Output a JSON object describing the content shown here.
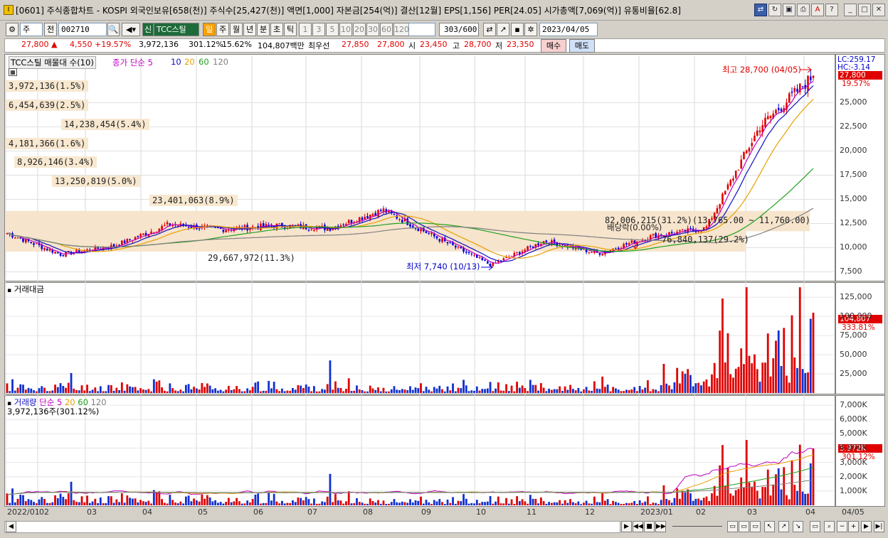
{
  "window": {
    "title": "[0601] 주식종합차트 - KOSPI 외국인보유[658(천)] 주식수[25,427(천)] 액면[1,000] 자본금[254(억)] 결산[12월] EPS[1,156] PER[24.05] 시가총액[7,069(억)] 유통비율[62.8]",
    "app_icon": "I"
  },
  "toolbar": {
    "market_type": "주",
    "prev_label": "전",
    "code": "002710",
    "stock_name": "TCC스틸",
    "stock_badge": "신",
    "periods": [
      "일",
      "주",
      "월",
      "년",
      "분",
      "초",
      "틱"
    ],
    "active_period": "일",
    "intervals": [
      "1",
      "3",
      "5",
      "10",
      "20",
      "30",
      "60",
      "120"
    ],
    "count_value": "303",
    "count_total": "/600",
    "date": "2023/04/05"
  },
  "pricebar": {
    "price": "27,800",
    "arrow": "▲",
    "change": "4,550",
    "change_pct": "+19.57%",
    "volume": "3,972,136",
    "vol_ratio": "301.12%",
    "turnover": "15.62%",
    "amount": "104,807백만",
    "best_label": "최우선",
    "ask": "27,850",
    "bid": "27,800",
    "open_label": "시",
    "open": "23,450",
    "high_label": "고",
    "high": "28,700",
    "low_label": "저",
    "low": "23,350",
    "buy_label": "매수",
    "sell_label": "매도"
  },
  "price_panel": {
    "legend_name": "TCC스틸 매물대 수(10)",
    "legend_ma": "종가 단순 5",
    "ma_periods": [
      "10",
      "20",
      "60",
      "120"
    ],
    "ma_colors": [
      "#c000c0",
      "#1010c0",
      "#e8a000",
      "#20a020",
      "#808080"
    ],
    "top_right_lc": "LC:259.17",
    "top_right_hc": "HC:-3.14",
    "last_price": "27,800",
    "last_pct": "19.57%",
    "high_note": "최고 28,700 (04/05)",
    "low_note": "최저 7,740 (10/13)",
    "dividend_note": "배당락(0.00%)",
    "vp_labels": [
      "3,972,136(1.5%)",
      "6,454,639(2.5%)",
      "14,238,454(5.4%)",
      "4,181,366(1.6%)",
      "8,926,146(3.4%)",
      "13,250,819(5.0%)",
      "23,401,063(8.9%)",
      "82,006,215(31.2%)(13,765.00 ~ 11,760.00)",
      "76,840,137(29.2%)",
      "29,667,972(11.3%)"
    ]
  },
  "amount_panel": {
    "title": "거래대금",
    "last_value": "104,807",
    "last_pct": "333.81%"
  },
  "volume_panel": {
    "legend_name": "거래량",
    "legend_ma": "단순 5",
    "ma_periods": [
      "20",
      "60",
      "120"
    ],
    "sub_label": "3,972,136주(301.12%)",
    "last_value": "3,972K",
    "last_pct": "301.12%"
  },
  "chart_data": [
    {
      "type": "candlestick",
      "title": "TCC스틸 일봉",
      "x_range": [
        "2022/01/02",
        "2023/04/05"
      ],
      "y_ticks": [
        "7,500",
        "10,000",
        "12,500",
        "15,000",
        "17,500",
        "20,000",
        "22,500",
        "25,000"
      ],
      "ylim": [
        6800,
        29300
      ],
      "series_closes_monthly": [
        {
          "x": "2022/01",
          "y": 11500
        },
        {
          "x": "2022/02",
          "y": 9300
        },
        {
          "x": "2022/03",
          "y": 10200
        },
        {
          "x": "2022/04",
          "y": 12400
        },
        {
          "x": "2022/05",
          "y": 11900
        },
        {
          "x": "2022/06",
          "y": 12300
        },
        {
          "x": "2022/07",
          "y": 12000
        },
        {
          "x": "2022/08",
          "y": 13900
        },
        {
          "x": "2022/09",
          "y": 11000
        },
        {
          "x": "2022/10",
          "y": 8200
        },
        {
          "x": "2022/11",
          "y": 10700
        },
        {
          "x": "2022/12",
          "y": 9400
        },
        {
          "x": "2023/01",
          "y": 11200
        },
        {
          "x": "2023/02",
          "y": 12000
        },
        {
          "x": "2023/03",
          "y": 22500
        },
        {
          "x": "2023/04",
          "y": 27800
        }
      ],
      "high": 28700,
      "low": 7740
    },
    {
      "type": "bar",
      "title": "거래대금",
      "y_ticks": [
        "25,000",
        "50,000",
        "75,000",
        "100,000",
        "125,000"
      ],
      "ylim": [
        0,
        140000
      ]
    },
    {
      "type": "bar",
      "title": "거래량",
      "y_ticks": [
        "1,000K",
        "2,000K",
        "3,000K",
        "4,000K",
        "5,000K",
        "6,000K",
        "7,000K"
      ],
      "ylim": [
        0,
        7500000
      ]
    }
  ],
  "x_axis_labels": [
    "2022/01",
    "02",
    "03",
    "04",
    "05",
    "06",
    "07",
    "08",
    "09",
    "10",
    "11",
    "12",
    "2023/01",
    "02",
    "03",
    "04",
    "04/05"
  ]
}
